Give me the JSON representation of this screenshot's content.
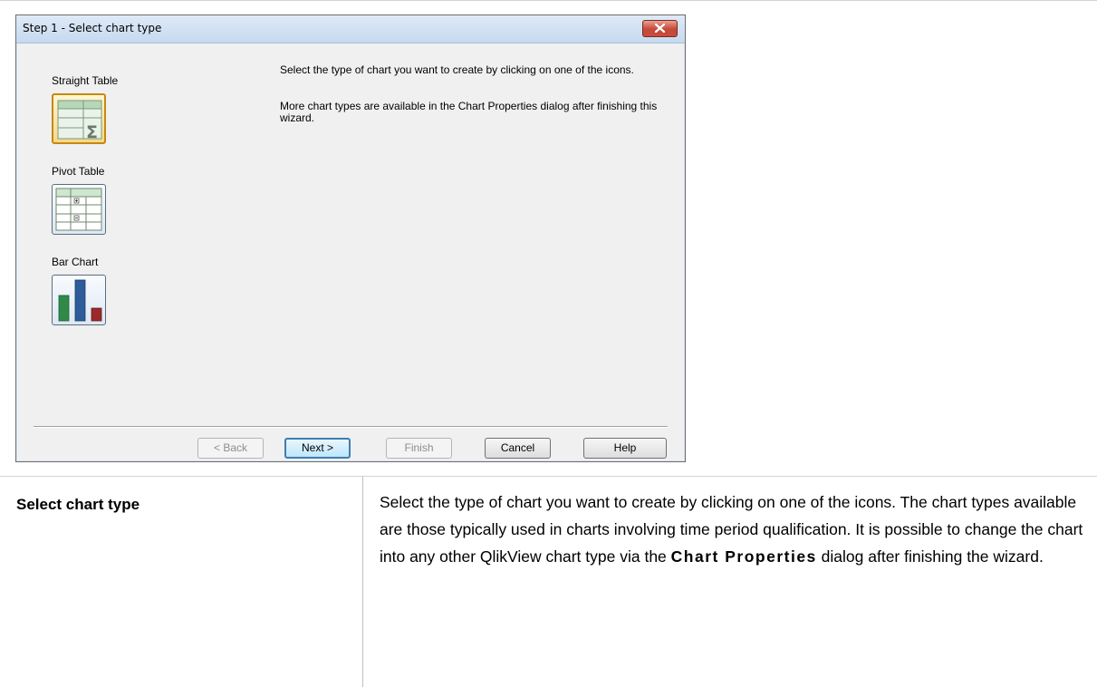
{
  "dialog": {
    "title": "Step 1 - Select chart type",
    "chart_types": [
      {
        "label": "Straight Table",
        "icon": "straight-table-icon",
        "selected": true
      },
      {
        "label": "Pivot Table",
        "icon": "pivot-table-icon",
        "selected": false
      },
      {
        "label": "Bar Chart",
        "icon": "bar-chart-icon",
        "selected": false
      }
    ],
    "description_1": "Select the type of chart you want to create by clicking on one of the icons.",
    "description_2": "More chart types are available in the Chart Properties dialog after finishing this wizard.",
    "buttons": {
      "back": "< Back",
      "next": "Next >",
      "finish": "Finish",
      "cancel": "Cancel",
      "help": "Help"
    }
  },
  "doc_table": {
    "term": "Select chart type",
    "definition_before": "Select the type of chart you want to create by clicking on one of the icons. The chart types available are those typically used in charts involving time period qualification. It is possible to change the chart into any other QlikView chart type via the",
    "definition_bold": "Chart Properties",
    "definition_after": "dialog after finishing the wizard."
  },
  "colors": {
    "titlebar": "#c6d9ef",
    "close_button": "#c84c3c",
    "selected_icon": "#f7d889",
    "default_button_border": "#3c7fb1"
  }
}
